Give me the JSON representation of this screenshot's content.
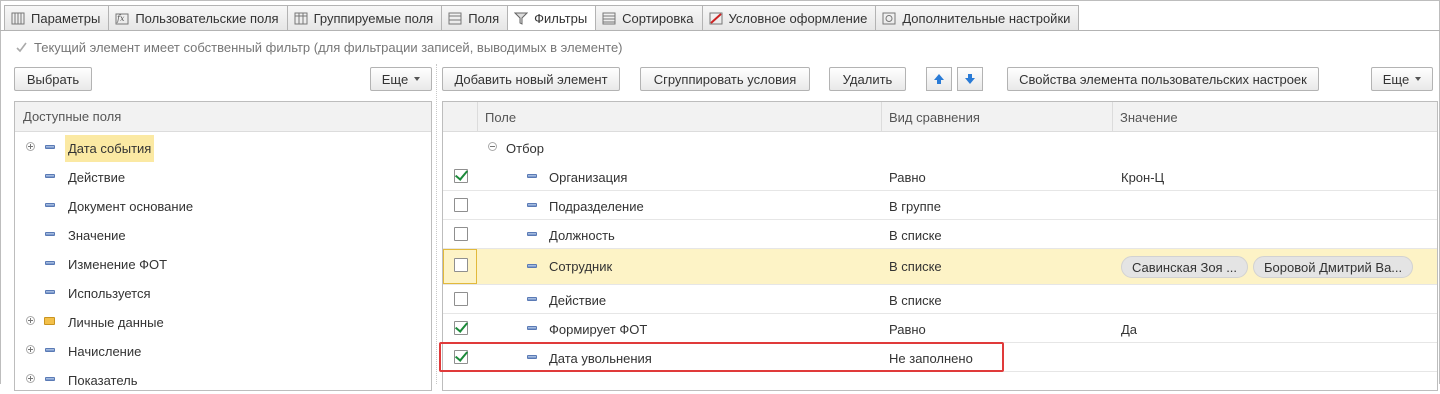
{
  "tabs": [
    {
      "label": "Параметры",
      "icon": "parameters-icon",
      "active": false
    },
    {
      "label": "Пользовательские поля",
      "icon": "function-icon",
      "active": false
    },
    {
      "label": "Группируемые поля",
      "icon": "grid-icon",
      "active": false
    },
    {
      "label": "Поля",
      "icon": "fields-icon",
      "active": false
    },
    {
      "label": "Фильтры",
      "icon": "filter-icon",
      "active": true
    },
    {
      "label": "Сортировка",
      "icon": "sort-icon",
      "active": false
    },
    {
      "label": "Условное оформление",
      "icon": "brush-icon",
      "active": false
    },
    {
      "label": "Дополнительные настройки",
      "icon": "settings-icon",
      "active": false
    }
  ],
  "info_text": "Текущий элемент имеет собственный фильтр (для фильтрации записей, выводимых в элементе)",
  "left_toolbar": {
    "select_label": "Выбрать",
    "more_label": "Еще"
  },
  "right_toolbar": {
    "add_label": "Добавить новый элемент",
    "group_label": "Сгруппировать условия",
    "delete_label": "Удалить",
    "up_icon": "arrow-up-icon",
    "down_icon": "arrow-down-icon",
    "props_label": "Свойства элемента пользовательских настроек",
    "more_label": "Еще"
  },
  "available_fields": {
    "header": "Доступные поля",
    "items": [
      {
        "label": "Дата события",
        "expandable": true,
        "icon": "field-icon",
        "highlighted": true
      },
      {
        "label": "Действие",
        "expandable": false,
        "icon": "field-icon",
        "highlighted": false
      },
      {
        "label": "Документ основание",
        "expandable": false,
        "icon": "field-icon",
        "highlighted": false
      },
      {
        "label": "Значение",
        "expandable": false,
        "icon": "field-icon",
        "highlighted": false
      },
      {
        "label": "Изменение ФОТ",
        "expandable": false,
        "icon": "field-icon",
        "highlighted": false
      },
      {
        "label": "Используется",
        "expandable": false,
        "icon": "field-icon",
        "highlighted": false
      },
      {
        "label": "Личные данные",
        "expandable": true,
        "icon": "folder-icon",
        "highlighted": false
      },
      {
        "label": "Начисление",
        "expandable": true,
        "icon": "field-icon",
        "highlighted": false
      },
      {
        "label": "Показатель",
        "expandable": true,
        "icon": "field-icon",
        "highlighted": false
      }
    ]
  },
  "filters_table": {
    "columns": [
      "Поле",
      "Вид сравнения",
      "Значение"
    ],
    "group_label": "Отбор",
    "rows": [
      {
        "checked": true,
        "field": "Организация",
        "comparison": "Равно",
        "value": "Крон-Ц"
      },
      {
        "checked": false,
        "field": "Подразделение",
        "comparison": "В группе",
        "value": ""
      },
      {
        "checked": false,
        "field": "Должность",
        "comparison": "В списке",
        "value": ""
      },
      {
        "checked": false,
        "field": "Сотрудник",
        "comparison": "В списке",
        "value": "",
        "values": [
          "Савинская Зоя ...",
          "Боровой Дмитрий Ва..."
        ],
        "selected": true
      },
      {
        "checked": false,
        "field": "Действие",
        "comparison": "В списке",
        "value": ""
      },
      {
        "checked": true,
        "field": "Формирует ФОТ",
        "comparison": "Равно",
        "value": "Да"
      },
      {
        "checked": true,
        "field": "Дата увольнения",
        "comparison": "Не заполнено",
        "value": "",
        "highlighted": true
      }
    ]
  },
  "colors": {
    "accent_check": "#1c8a3a",
    "highlight": "#fbe9a3",
    "selected_row": "#fdf3c6",
    "red_frame": "#e03a3a"
  }
}
